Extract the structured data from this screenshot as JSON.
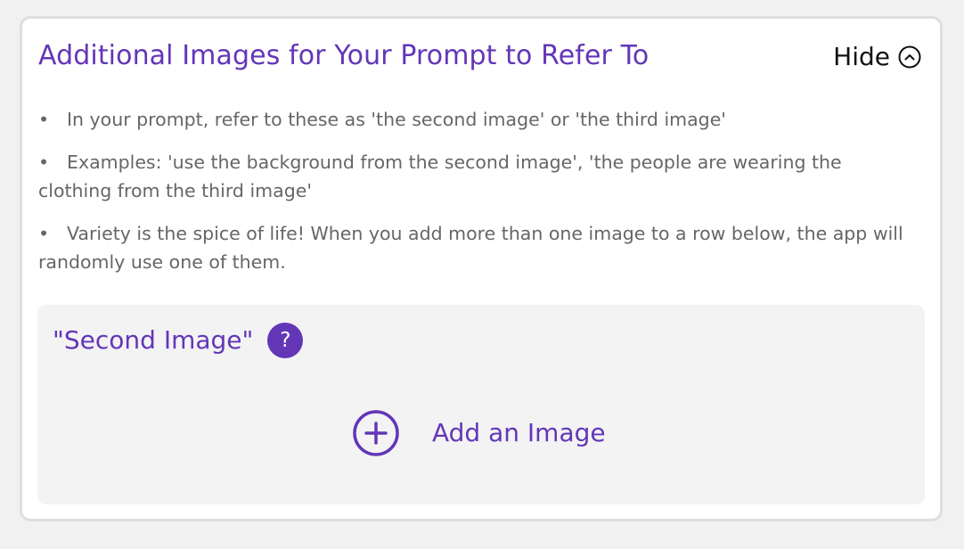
{
  "panel": {
    "title": "Additional Images for Your Prompt to Refer To",
    "hide_label": "Hide",
    "hide_icon": "chevron-up-circle-icon"
  },
  "bullets": [
    {
      "marker": "•",
      "text": "In your prompt, refer to these as 'the second image' or 'the third image'"
    },
    {
      "marker": "•",
      "text": "Examples: 'use the background from the second image', 'the people are wearing the clothing from the third image'"
    },
    {
      "marker": "•",
      "text": "Variety is the spice of life! When you add more than one image to a row below, the app will randomly use one of them."
    }
  ],
  "image_slot": {
    "title": "\"Second Image\"",
    "help_glyph": "?",
    "help_icon": "question-circle-icon",
    "add_label": "Add an Image",
    "add_icon": "plus-circle-icon"
  },
  "colors": {
    "accent": "#6336b8",
    "body_text": "#666666",
    "page_bg": "#f1f1f1",
    "panel_bg": "#ffffff",
    "slot_bg": "#f3f3f4"
  }
}
